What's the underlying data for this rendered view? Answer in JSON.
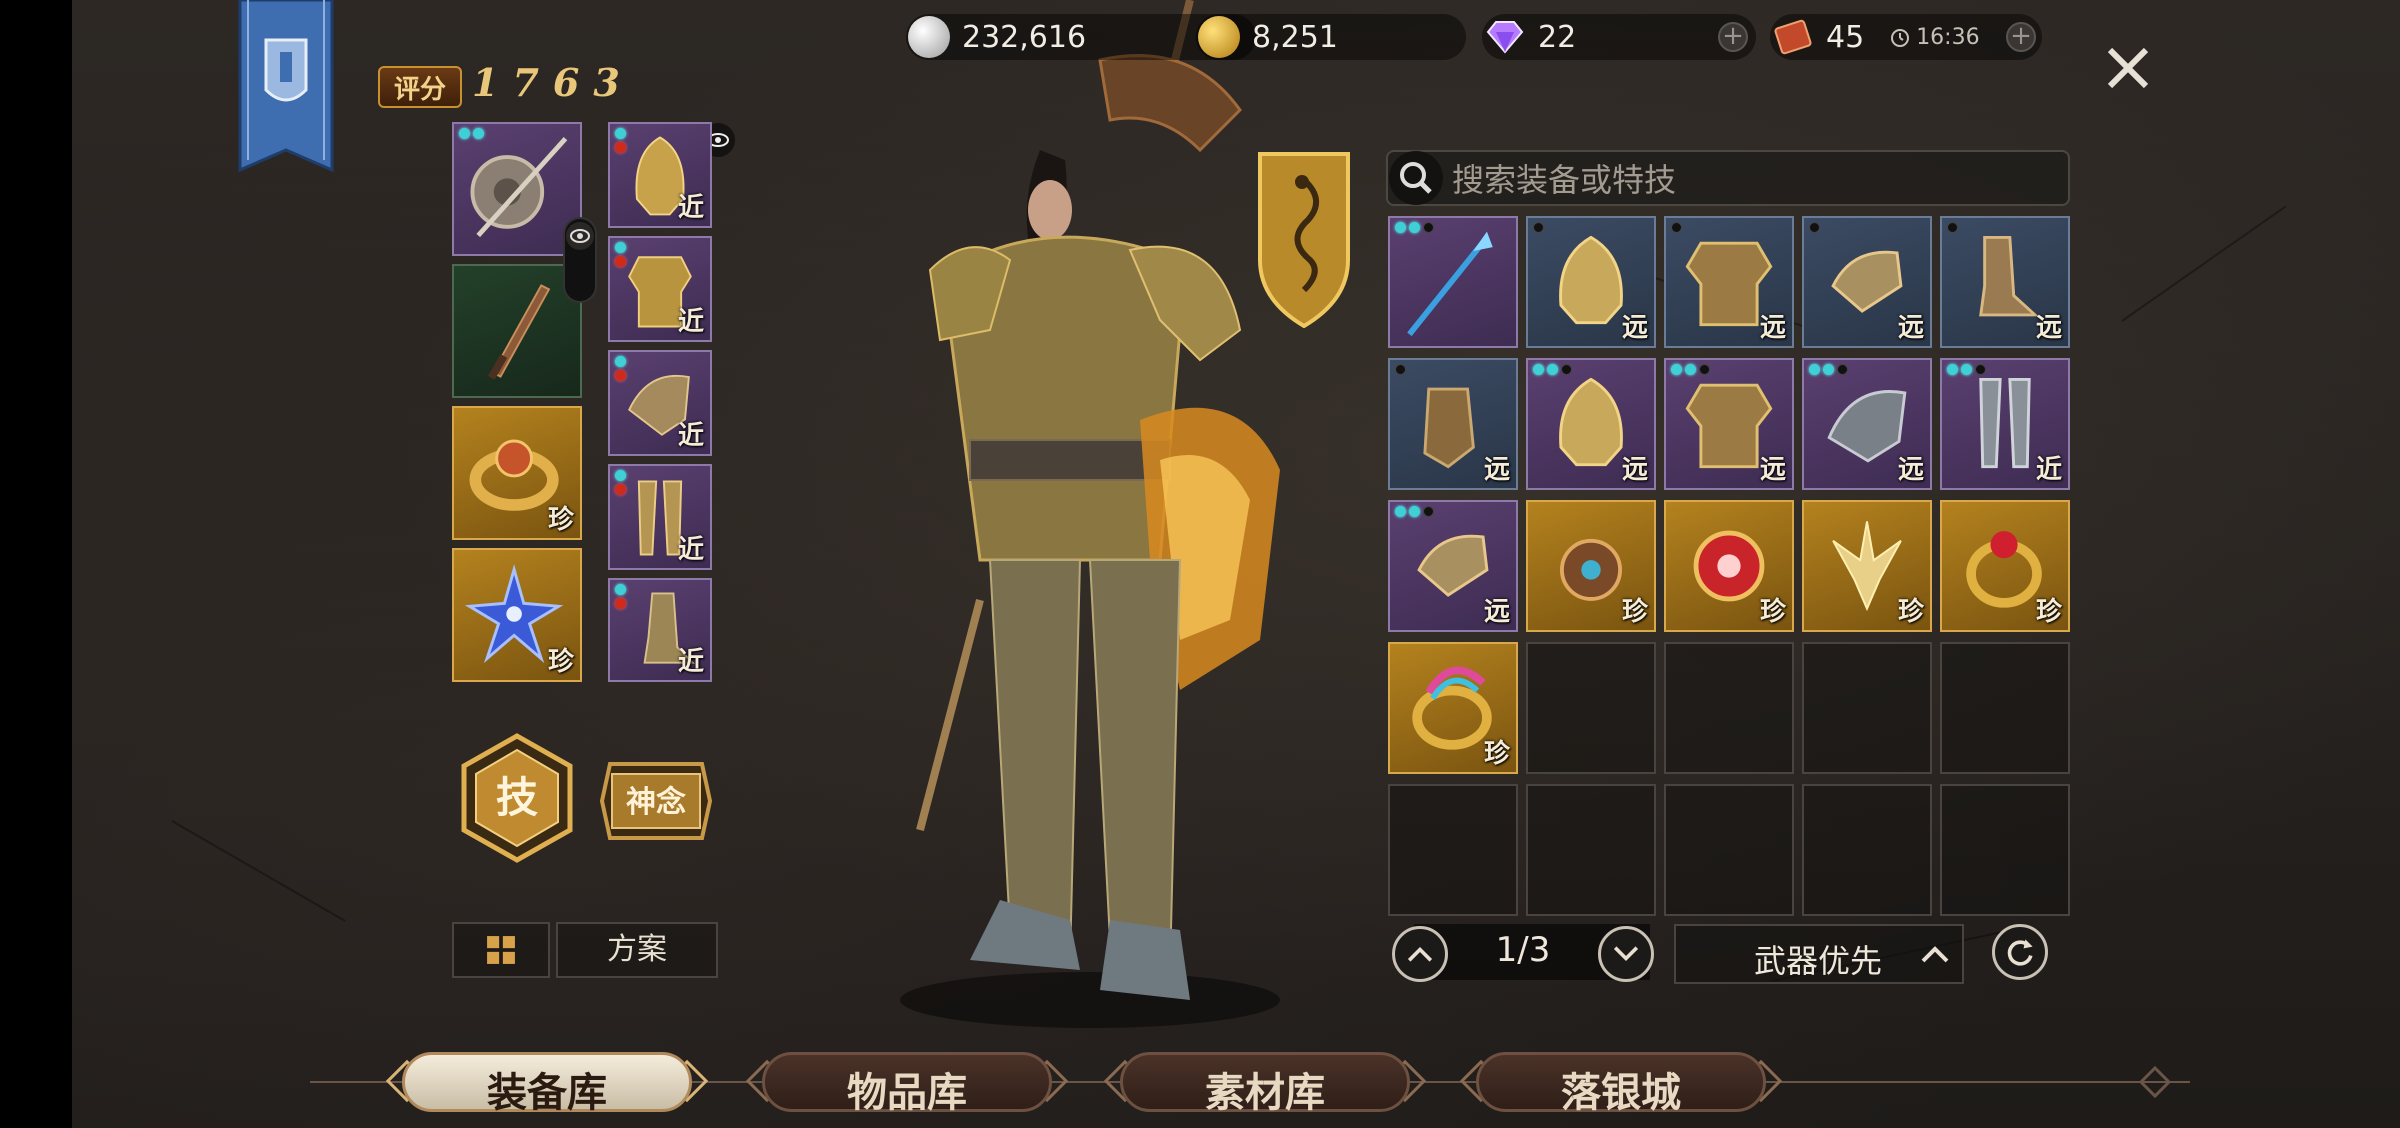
{
  "header": {
    "score_label": "评分",
    "score_value": "1763",
    "currencies": [
      {
        "name": "silver",
        "value": "232,616",
        "icon": "silver-coin-icon",
        "color": "#c8c8c8"
      },
      {
        "name": "gold",
        "value": "8,251",
        "icon": "gold-coin-icon",
        "color": "#d9a520"
      },
      {
        "name": "diamond",
        "value": "22",
        "icon": "diamond-icon",
        "color": "#b77bff"
      },
      {
        "name": "ticket",
        "value": "45",
        "icon": "ticket-icon",
        "color": "#c24a2a"
      }
    ],
    "timer": "16:36"
  },
  "equipped": {
    "weapons": [
      {
        "slot": "main-weapon",
        "rarity": "purple",
        "tag": ""
      },
      {
        "slot": "off-weapon",
        "rarity": "green",
        "tag": ""
      },
      {
        "slot": "accessory-1",
        "rarity": "gold",
        "tag": "珍"
      },
      {
        "slot": "accessory-2",
        "rarity": "gold",
        "tag": "珍"
      }
    ],
    "armor": [
      {
        "slot": "helmet",
        "rarity": "purple",
        "tag": "近"
      },
      {
        "slot": "chest",
        "rarity": "purple",
        "tag": "近"
      },
      {
        "slot": "shoulder",
        "rarity": "purple",
        "tag": "近"
      },
      {
        "slot": "legs",
        "rarity": "purple",
        "tag": "近"
      },
      {
        "slot": "boots",
        "rarity": "purple",
        "tag": "近"
      }
    ]
  },
  "buttons": {
    "skill": "技",
    "mind": "神念",
    "plan": "方案"
  },
  "search": {
    "placeholder": "搜索装备或特技"
  },
  "inventory": [
    {
      "rarity": "purple",
      "tag": "",
      "item": "staff"
    },
    {
      "rarity": "blue",
      "tag": "远",
      "item": "helmet"
    },
    {
      "rarity": "blue",
      "tag": "远",
      "item": "chest"
    },
    {
      "rarity": "blue",
      "tag": "远",
      "item": "gauntlet"
    },
    {
      "rarity": "blue",
      "tag": "远",
      "item": "boots"
    },
    {
      "rarity": "blue",
      "tag": "远",
      "item": "glove"
    },
    {
      "rarity": "purple",
      "tag": "远",
      "item": "helmet"
    },
    {
      "rarity": "purple",
      "tag": "远",
      "item": "chest"
    },
    {
      "rarity": "purple",
      "tag": "远",
      "item": "shoulder"
    },
    {
      "rarity": "purple",
      "tag": "近",
      "item": "legs"
    },
    {
      "rarity": "purple",
      "tag": "远",
      "item": "gauntlet"
    },
    {
      "rarity": "gold",
      "tag": "珍",
      "item": "amulet"
    },
    {
      "rarity": "gold",
      "tag": "珍",
      "item": "gem"
    },
    {
      "rarity": "gold",
      "tag": "珍",
      "item": "charm"
    },
    {
      "rarity": "gold",
      "tag": "珍",
      "item": "ring"
    },
    {
      "rarity": "gold",
      "tag": "珍",
      "item": "rainbow-ring"
    },
    {
      "rarity": "empty",
      "tag": "",
      "item": ""
    },
    {
      "rarity": "empty",
      "tag": "",
      "item": ""
    },
    {
      "rarity": "empty",
      "tag": "",
      "item": ""
    },
    {
      "rarity": "empty",
      "tag": "",
      "item": ""
    },
    {
      "rarity": "empty",
      "tag": "",
      "item": ""
    },
    {
      "rarity": "empty",
      "tag": "",
      "item": ""
    },
    {
      "rarity": "empty",
      "tag": "",
      "item": ""
    },
    {
      "rarity": "empty",
      "tag": "",
      "item": ""
    },
    {
      "rarity": "empty",
      "tag": "",
      "item": ""
    }
  ],
  "pagination": {
    "page": "1/3",
    "sort_label": "武器优先"
  },
  "tabs": [
    {
      "label": "装备库",
      "active": true
    },
    {
      "label": "物品库",
      "active": false
    },
    {
      "label": "素材库",
      "active": false
    },
    {
      "label": "落银城",
      "active": false
    }
  ],
  "colors": {
    "gold_accent": "#d9a84a",
    "purple_rarity": "#5a4070",
    "blue_rarity": "#3b4b63",
    "gold_rarity": "#b4821e"
  }
}
